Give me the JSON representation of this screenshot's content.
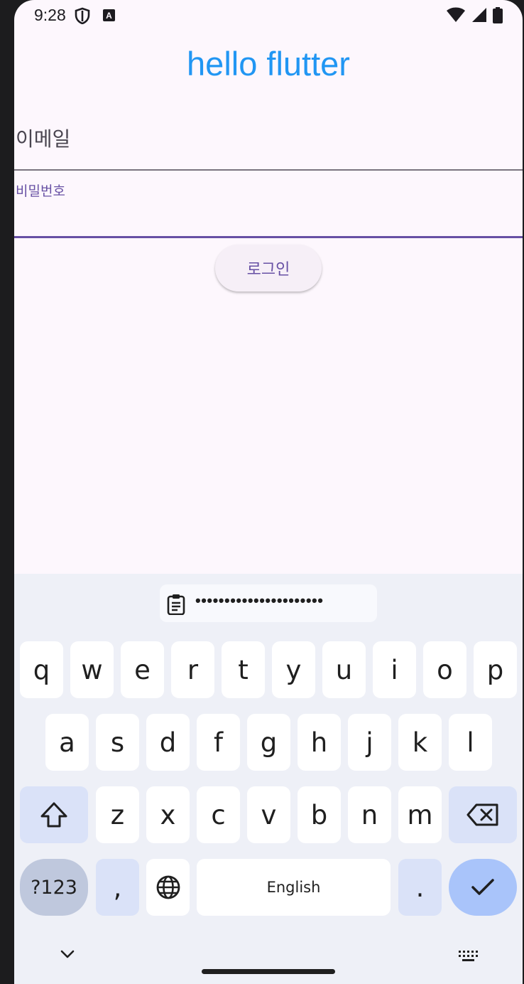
{
  "status_bar": {
    "time": "9:28",
    "icons": [
      "shield-icon",
      "keyboard-a-icon",
      "wifi-icon",
      "signal-icon",
      "battery-icon"
    ]
  },
  "app": {
    "title": "hello flutter",
    "title_color": "#2196f3",
    "email_label": "이메일",
    "password_label": "비밀번호",
    "login_label": "로그인",
    "accent_color": "#6750a4"
  },
  "keyboard": {
    "clipboard_suggestion": "••••••••••••••••••••••",
    "row1": [
      "q",
      "w",
      "e",
      "r",
      "t",
      "y",
      "u",
      "i",
      "o",
      "p"
    ],
    "row2": [
      "a",
      "s",
      "d",
      "f",
      "g",
      "h",
      "j",
      "k",
      "l"
    ],
    "row3": [
      "z",
      "x",
      "c",
      "v",
      "b",
      "n",
      "m"
    ],
    "symbols_label": "?123",
    "comma_label": ",",
    "space_label": "English",
    "period_label": ".",
    "icons": [
      "shift-icon",
      "backspace-icon",
      "globe-icon",
      "enter-check-icon",
      "hide-keyboard-icon",
      "keyboard-switch-icon"
    ]
  }
}
